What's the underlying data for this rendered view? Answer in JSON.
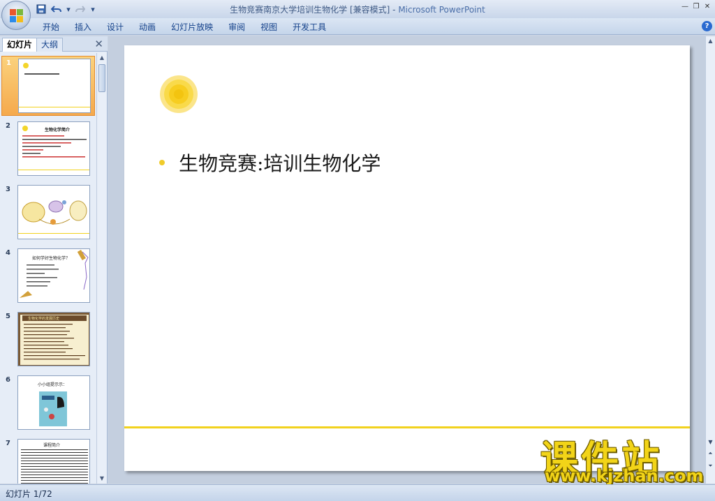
{
  "window": {
    "title_doc": "生物竞赛南京大学培训生物化学 [兼容模式]",
    "title_sep": " - ",
    "title_app": "Microsoft PowerPoint"
  },
  "quick_access": {
    "items": [
      "save-icon",
      "undo-icon",
      "redo-icon",
      "customize-icon"
    ]
  },
  "ribbon": {
    "tabs": [
      "开始",
      "插入",
      "设计",
      "动画",
      "幻灯片放映",
      "审阅",
      "视图",
      "开发工具"
    ]
  },
  "left_pane": {
    "tab_slides": "幻灯片",
    "tab_outline": "大纲",
    "thumbnails": [
      {
        "num": "1",
        "selected": true
      },
      {
        "num": "2",
        "selected": false
      },
      {
        "num": "3",
        "selected": false
      },
      {
        "num": "4",
        "selected": false
      },
      {
        "num": "5",
        "selected": false
      },
      {
        "num": "6",
        "selected": false
      },
      {
        "num": "7",
        "selected": false
      }
    ],
    "thumb_texts": {
      "t2_title": "生物化学简介",
      "t4_title": "如何学好生物化学？",
      "t5_title": "生物化学的发展历史",
      "t6_title": "小小组提示示：",
      "t7_title": "课程简介"
    }
  },
  "slide": {
    "bullet_text": "生物竞赛:培训生物化学",
    "accent_color": "#f2d21e"
  },
  "watermark": {
    "cn": "课件站",
    "en": "www.kjzhan.com"
  },
  "status": {
    "slide_info": "幻灯片 1/72"
  }
}
